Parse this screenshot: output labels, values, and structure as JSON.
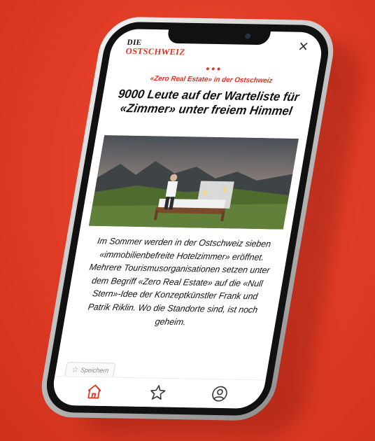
{
  "app": {
    "logo_line1": "DIE",
    "logo_line2": "OSTSCHWEIZ",
    "accent_color": "#e1301f",
    "close_icon": "close-icon"
  },
  "article": {
    "kicker": "«Zero Real Estate» in der Ostschweiz",
    "headline": "9000 Leute auf der Warteliste für «Zimmer» unter freiem Himmel",
    "body": "Im Sommer werden in der Ostschweiz sieben «immobilienbefreite Hotelzimmer» eröffnet. Mehrere Tourismusorganisationen setzen unter dem Begriff «Zero Real Estate» auf die «Null Stern»-Idee der Konzeptkünstler Frank und Patrik Riklin. Wo die Standorte sind, ist noch geheim.",
    "save_label": "Speichern"
  },
  "tabbar": {
    "items": [
      {
        "icon": "home-icon",
        "active": true
      },
      {
        "icon": "star-icon",
        "active": false
      },
      {
        "icon": "profile-icon",
        "active": false
      }
    ]
  }
}
